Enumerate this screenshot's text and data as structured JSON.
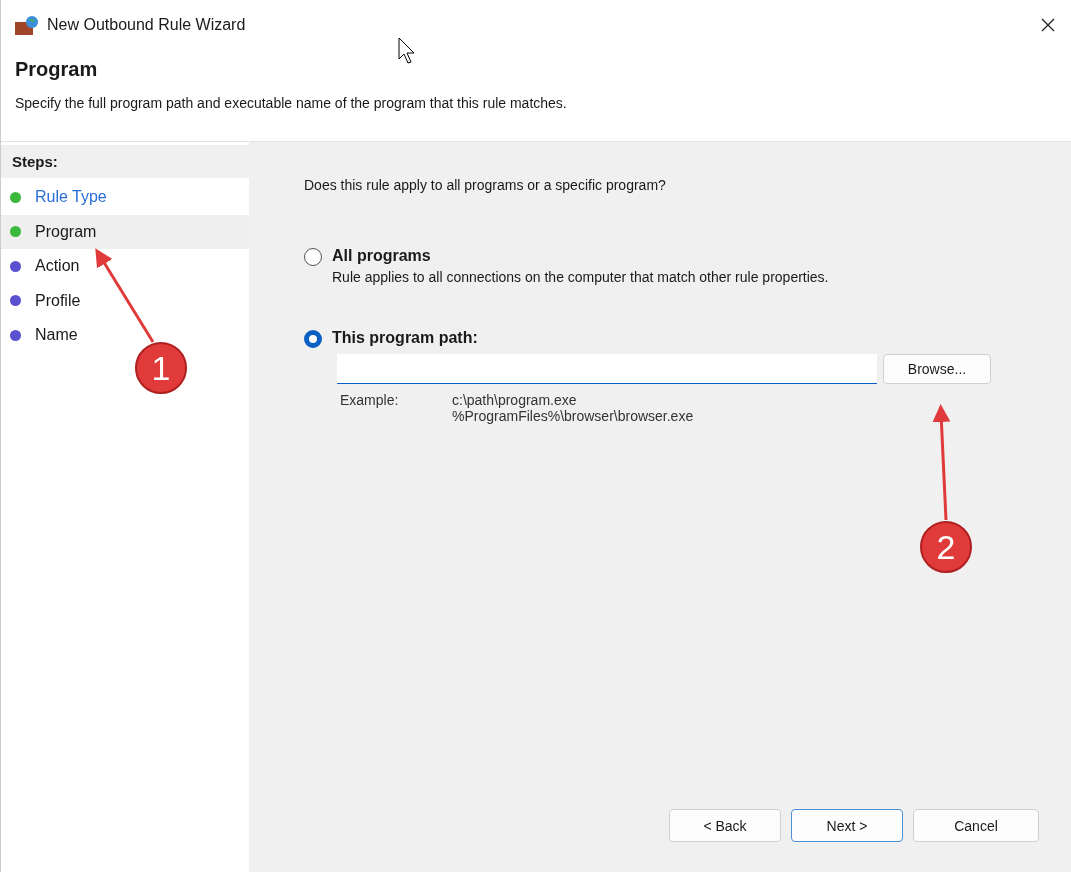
{
  "window": {
    "title": "New Outbound Rule Wizard"
  },
  "header": {
    "title": "Program",
    "description": "Specify the full program path and executable name of the program that this rule matches."
  },
  "steps": {
    "title": "Steps:",
    "items": [
      {
        "label": "Rule Type",
        "selected": false,
        "link": true,
        "color": "#3cb83c"
      },
      {
        "label": "Program",
        "selected": true,
        "link": false,
        "color": "#3cb83c"
      },
      {
        "label": "Action",
        "selected": false,
        "link": false,
        "color": "#5a50d0"
      },
      {
        "label": "Profile",
        "selected": false,
        "link": false,
        "color": "#5a50d0"
      },
      {
        "label": "Name",
        "selected": false,
        "link": false,
        "color": "#5a50d0"
      }
    ]
  },
  "question": "Does this rule apply to all programs or a specific program?",
  "options": [
    {
      "label": "All programs",
      "description": "Rule applies to all connections on the computer that match other rule properties.",
      "selected": false
    },
    {
      "label": "This program path:",
      "selected": true
    }
  ],
  "browse_button": "Browse...",
  "example": {
    "label": "Example:",
    "lines": [
      "c:\\path\\program.exe",
      "%ProgramFiles%\\browser\\browser.exe"
    ]
  },
  "buttons": [
    {
      "label": "< Back",
      "default": false
    },
    {
      "label": "Next >",
      "default": true
    },
    {
      "label": "Cancel",
      "default": false
    }
  ],
  "annotations": [
    {
      "number": "1"
    },
    {
      "number": "2"
    }
  ]
}
